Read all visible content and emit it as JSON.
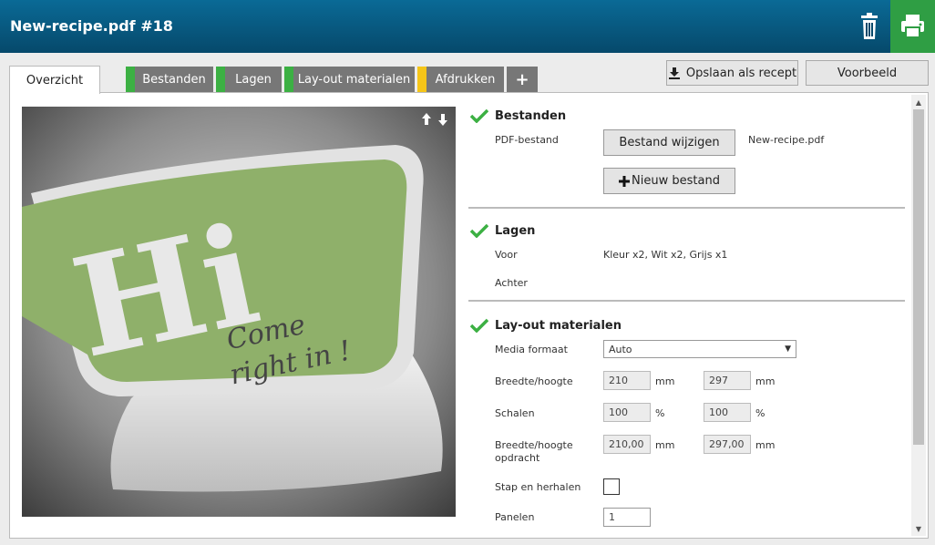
{
  "header": {
    "title": "New-recipe.pdf #18"
  },
  "tabs": [
    {
      "label": "Overzicht",
      "status_color": ""
    },
    {
      "label": "Bestanden",
      "status_color": "#3cb043"
    },
    {
      "label": "Lagen",
      "status_color": "#3cb043"
    },
    {
      "label": "Lay-out materialen",
      "status_color": "#3cb043"
    },
    {
      "label": "Afdrukken",
      "status_color": "#f5c518"
    },
    {
      "label": "+"
    }
  ],
  "actions": {
    "save_recipe": "Opslaan als recept",
    "preview": "Voorbeeld"
  },
  "preview_image": {
    "line1": "Hi",
    "line2": "Come",
    "line3": "right in !"
  },
  "bestanden": {
    "title": "Bestanden",
    "pdf_label": "PDF-bestand",
    "change_button": "Bestand wijzigen",
    "file_name": "New-recipe.pdf",
    "new_button": "Nieuw bestand"
  },
  "lagen": {
    "title": "Lagen",
    "front_label": "Voor",
    "front_value": "Kleur x2, Wit x2, Grijs x1",
    "back_label": "Achter"
  },
  "layout": {
    "title": "Lay-out materialen",
    "media_label": "Media formaat",
    "media_value": "Auto",
    "wh_label": "Breedte/hoogte",
    "width": "210",
    "height": "297",
    "unit_mm": "mm",
    "scale_label": "Schalen",
    "scale_x": "100",
    "scale_y": "100",
    "unit_pct": "%",
    "job_wh_label_1": "Breedte/hoogte",
    "job_wh_label_2": "opdracht",
    "job_width": "210,00",
    "job_height": "297,00",
    "step_label": "Stap en herhalen",
    "panels_label": "Panelen",
    "panels_value": "1"
  },
  "colors": {
    "header": "#06496b",
    "print_button": "#2f9e44",
    "check": "#3cb043",
    "warning": "#f5c518"
  }
}
